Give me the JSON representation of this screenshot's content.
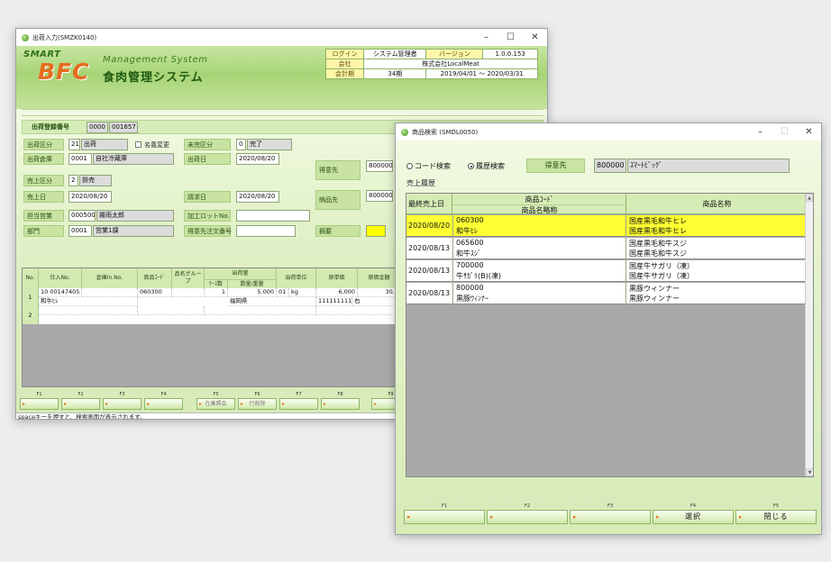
{
  "main_window": {
    "title": "出荷入力(SMZK0140)",
    "controls": [
      "–",
      "☐",
      "✕"
    ],
    "logo": {
      "smart": "SMART",
      "bfc": "BFC",
      "sub": "Management System",
      "title": "食肉管理システム"
    },
    "info": {
      "login_label": "ログイン",
      "login_value": "システム管理者",
      "version_label": "バージョン",
      "version_value": "1.0.0.153",
      "company_label": "会社",
      "company_value": "株式会社LocalMeat",
      "period_label": "会計期",
      "period_term": "34期",
      "period_range": "2019/04/01 ～ 2020/03/31"
    },
    "ship_no_label": "出荷登録番号",
    "ship_no_1": "0000",
    "ship_no_2": "001657",
    "register_button": "登録",
    "form": {
      "ship_type_label": "出荷区分",
      "ship_type_code": "21",
      "ship_type_name": "出荷",
      "name_change": "名義変更",
      "incomplete_label": "未完区分",
      "incomplete_code": "0",
      "incomplete_name": "完了",
      "warehouse_label": "出荷倉庫",
      "warehouse_code": "0001",
      "warehouse_name": "自社冷蔵庫",
      "ship_date_label": "出荷日",
      "ship_date": "2020/08/20",
      "customer_label": "得意先",
      "customer_code": "800000",
      "sales_type_label": "売上区分",
      "sales_type_code": "2",
      "sales_type_name": "掛売",
      "sales_date_label": "売上日",
      "sales_date": "2020/08/20",
      "billing_date_label": "請求日",
      "billing_date": "2020/08/20",
      "delivery_label": "納品先",
      "delivery_code": "800000",
      "rep_label": "担当営業",
      "rep_code": "000500",
      "rep_name": "霧雨太郎",
      "lot_label": "加工ロットNo.",
      "dept_label": "部門",
      "dept_code": "0001",
      "dept_name": "営業1課",
      "customer_order_label": "得意先注文番号",
      "memo_label": "摘要"
    },
    "grid": {
      "headers": {
        "no": "No.",
        "receipt_no": "仕入No.",
        "warehouse_in_no": "倉庫In.No.",
        "product_code": "商品ｺｰﾄﾞ",
        "product_group": "品名グループ",
        "ship_qty": "出荷量",
        "cases": "ｹｰｽ数",
        "qty_weight": "数量/重量",
        "unit": "出荷単位",
        "cost": "原単価",
        "cost_amount": "原価金額"
      },
      "row1": {
        "no": "1",
        "receipt_no": "10 00147405",
        "product_code": "060300",
        "product_name": "和牛ﾋﾚ",
        "cases": "1",
        "qty": "5.000",
        "unit_code": "01",
        "unit": "kg",
        "origin": "福岡県",
        "cost": "6,000",
        "cost_amount": "30.0",
        "lot": "1111111111",
        "lot_suffix": "右"
      },
      "row2_no": "2"
    },
    "fkeys": [
      {
        "num": "F1",
        "label": ""
      },
      {
        "num": "F2",
        "label": ""
      },
      {
        "num": "F3",
        "label": ""
      },
      {
        "num": "F4",
        "label": ""
      },
      {
        "num": "F5",
        "label": "在庫照会"
      },
      {
        "num": "F6",
        "label": "行削除"
      },
      {
        "num": "F7",
        "label": ""
      },
      {
        "num": "F8",
        "label": ""
      },
      {
        "num": "F9",
        "label": ""
      }
    ],
    "status": "spaceキーを押すと、検索画面が表示されます。"
  },
  "search_window": {
    "title": "商品検索 (SMDL0050)",
    "controls": [
      "–",
      "☐",
      "✕"
    ],
    "radio_code": "コード検索",
    "radio_history": "履歴検索",
    "customer_label": "得意先",
    "customer_code": "800000",
    "customer_name": "ｽﾏｰﾄﾋﾞｯｸﾞ",
    "section_label": "売上履歴",
    "grid_headers": {
      "last_sale": "最終売上日",
      "code": "商品ｺｰﾄﾞ",
      "short_name": "商品名略称",
      "name": "商品名称"
    },
    "rows": [
      {
        "date": "2020/08/20",
        "code": "060300",
        "short": "和牛ﾋﾚ",
        "name1": "国産黒毛和牛ヒレ",
        "name2": "国産黒毛和牛ヒレ",
        "selected": true
      },
      {
        "date": "2020/08/13",
        "code": "065600",
        "short": "和牛ｽｼﾞ",
        "name1": "国産黒毛和牛スジ",
        "name2": "国産黒毛和牛スジ",
        "selected": false
      },
      {
        "date": "2020/08/13",
        "code": "700000",
        "short": "牛ｻｶﾞﾘ(B)(凍)",
        "name1": "国産牛サガリ（凍）",
        "name2": "国産牛サガリ（凍）",
        "selected": false
      },
      {
        "date": "2020/08/13",
        "code": "800000",
        "short": "黒豚ｳｨﾝﾅｰ",
        "name1": "黒豚ウィンナー",
        "name2": "黒豚ウィンナー",
        "selected": false
      }
    ],
    "fkeys": [
      {
        "num": "F1",
        "label": ""
      },
      {
        "num": "F2",
        "label": ""
      },
      {
        "num": "F3",
        "label": ""
      },
      {
        "num": "F4",
        "label": "選択"
      },
      {
        "num": "F5",
        "label": "閉じる"
      }
    ]
  }
}
